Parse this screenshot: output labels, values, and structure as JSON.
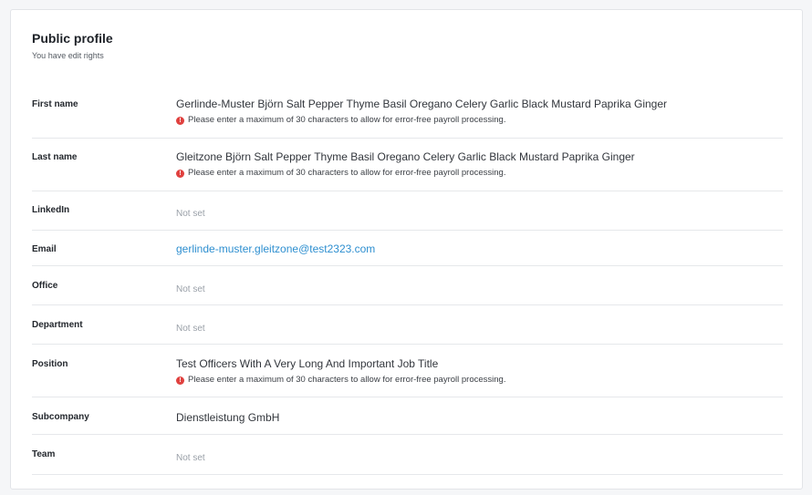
{
  "profile": {
    "title": "Public profile",
    "subtitle": "You have edit rights"
  },
  "colors": {
    "error": "#e0413f",
    "link": "#2e8fd0",
    "muted": "#9aa0a8"
  },
  "fields": {
    "first_name": {
      "label": "First name",
      "value": "Gerlinde-Muster Björn Salt Pepper Thyme Basil Oregano Celery Garlic Black Mustard Paprika Ginger",
      "error": "Please enter a maximum of 30 characters to allow for error-free payroll processing."
    },
    "last_name": {
      "label": "Last name",
      "value": "Gleitzone Björn Salt Pepper Thyme Basil Oregano Celery Garlic Black Mustard Paprika Ginger",
      "error": "Please enter a maximum of 30 characters to allow for error-free payroll processing."
    },
    "linkedin": {
      "label": "LinkedIn",
      "value": "Not set"
    },
    "email": {
      "label": "Email",
      "value": "gerlinde-muster.gleitzone@test2323.com"
    },
    "office": {
      "label": "Office",
      "value": "Not set"
    },
    "department": {
      "label": "Department",
      "value": "Not set"
    },
    "position": {
      "label": "Position",
      "value": "Test Officers With A Very Long And Important Job Title",
      "error": "Please enter a maximum of 30 characters to allow for error-free payroll processing."
    },
    "subcompany": {
      "label": "Subcompany",
      "value": "Dienstleistung GmbH"
    },
    "team": {
      "label": "Team",
      "value": "Not set"
    }
  },
  "icons": {
    "error_icon": "exclamation-circle-icon",
    "error_glyph": "!"
  }
}
